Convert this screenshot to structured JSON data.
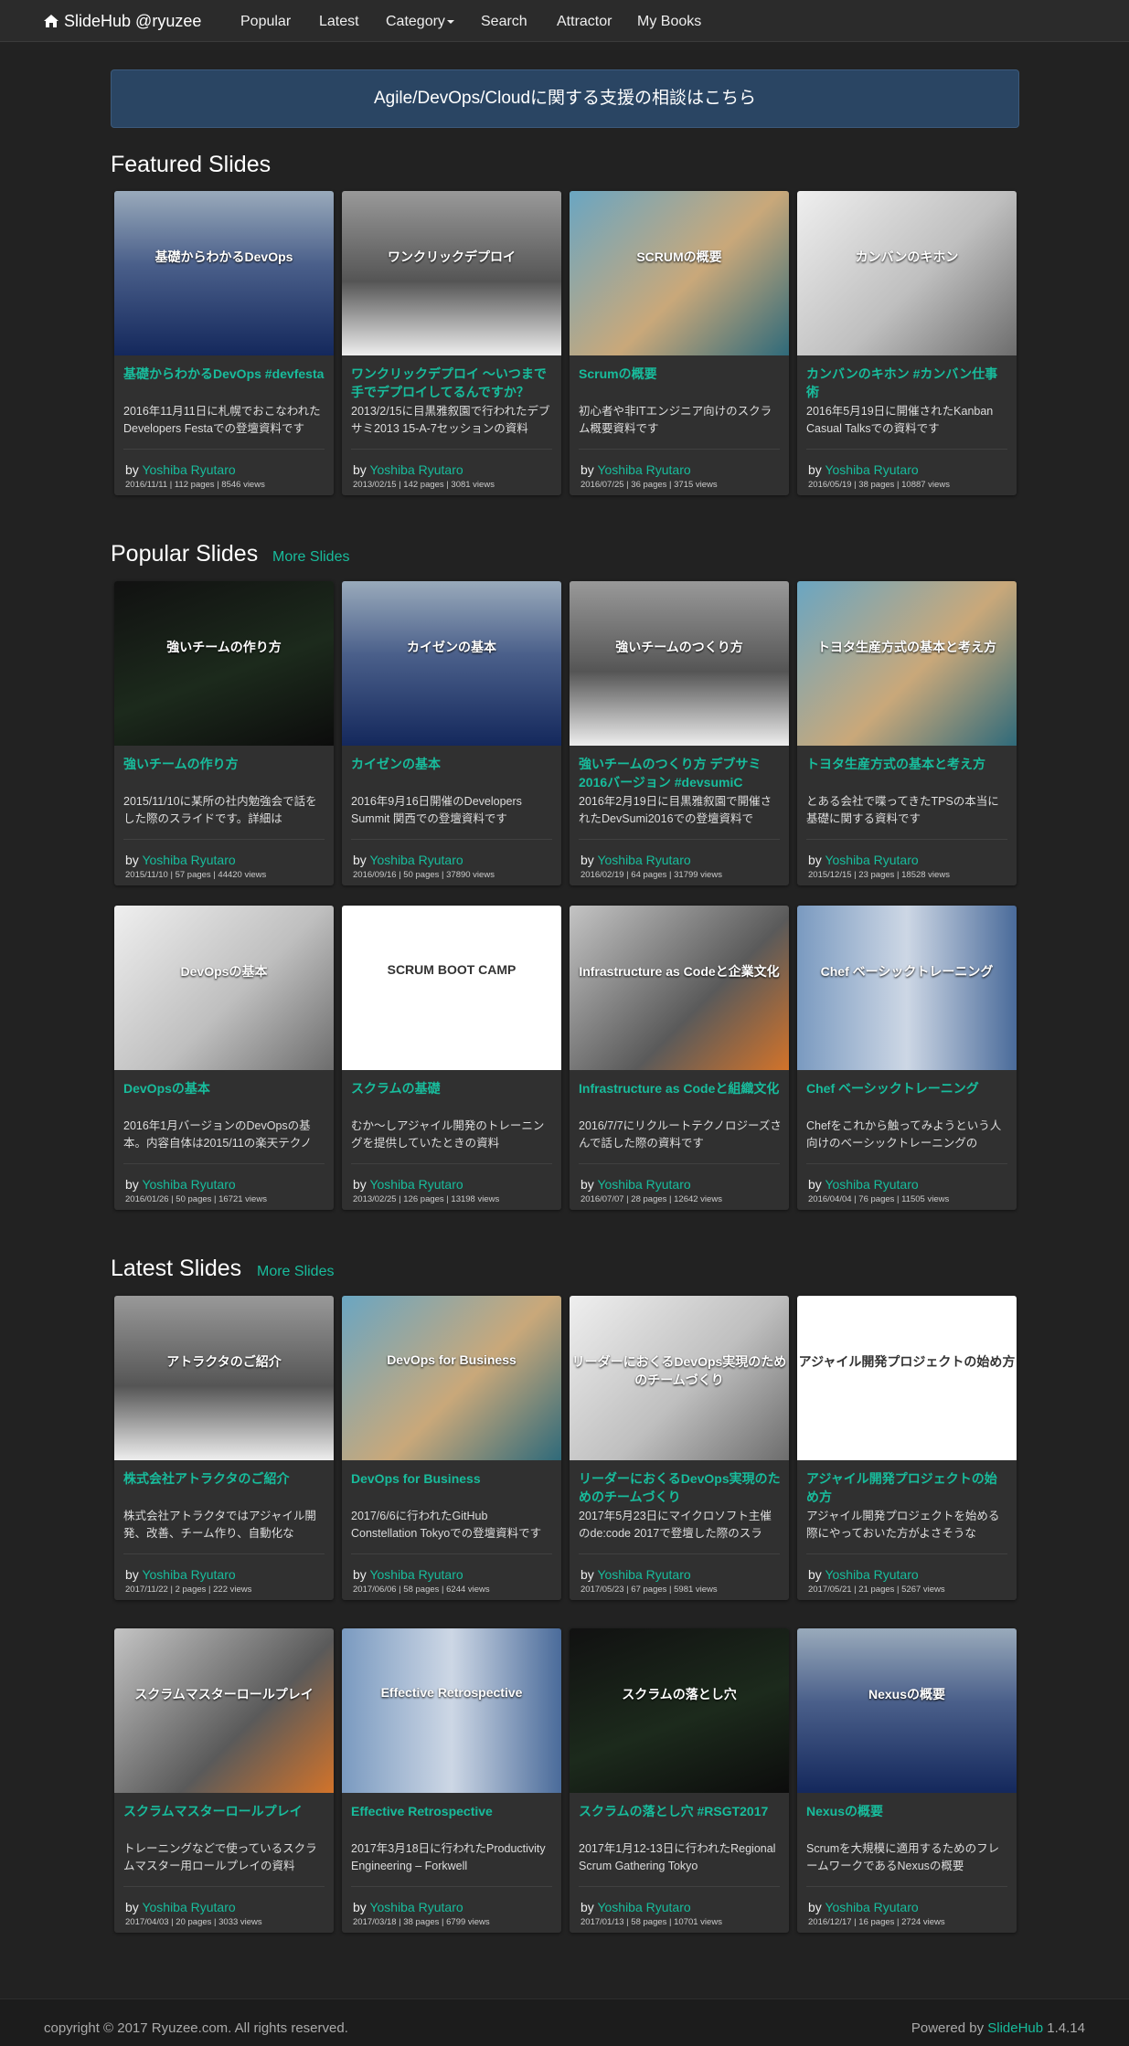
{
  "nav": {
    "brand": "SlideHub @ryuzee",
    "items": [
      "Popular",
      "Latest",
      "Category",
      "Search",
      "Attractor",
      "My Books"
    ]
  },
  "banner": {
    "text": "Agile/DevOps/Cloudに関する支援の相談はこちら"
  },
  "featured": {
    "title": "Featured Slides",
    "cards": [
      {
        "thumb_text": "基礎からわかるDevOps",
        "title": "基礎からわかるDevOps #devfesta",
        "desc": "2016年11月11日に札幌でおこなわれたDevelopers Festaでの登壇資料です",
        "by": "by ",
        "author": "Yoshiba Ryutaro",
        "meta": "2016/11/11 | 112 pages | 8546 views"
      },
      {
        "thumb_text": "ワンクリックデプロイ",
        "title": "ワンクリックデプロイ 〜いつまで手でデプロイしてるんですか？ #devsumiA",
        "desc": "2013/2/15に目黒雅叙園で行われたデブサミ2013 15-A-7セッションの資料",
        "by": "by ",
        "author": "Yoshiba Ryutaro",
        "meta": "2013/02/15 | 142 pages | 3081 views"
      },
      {
        "thumb_text": "SCRUMの概要",
        "title": "Scrumの概要",
        "desc": "初心者や非ITエンジニア向けのスクラム概要資料です",
        "by": "by ",
        "author": "Yoshiba Ryutaro",
        "meta": "2016/07/25 | 36 pages | 3715 views"
      },
      {
        "thumb_text": "カンバンのキホン",
        "title": "カンバンのキホン #カンバン仕事術",
        "desc": "2016年5月19日に開催されたKanban Casual Talksでの資料です",
        "by": "by ",
        "author": "Yoshiba Ryutaro",
        "meta": "2016/05/19 | 38 pages | 10887 views"
      }
    ]
  },
  "popular": {
    "title": "Popular Slides",
    "more": "More Slides",
    "cards": [
      {
        "thumb_text": "強いチームの作り方",
        "title": "強いチームの作り方",
        "desc": "2015/11/10に某所の社内勉強会で話をした際のスライドです。詳細は",
        "by": "by ",
        "author": "Yoshiba Ryutaro",
        "meta": "2015/11/10 | 57 pages | 44420 views"
      },
      {
        "thumb_text": "カイゼンの基本",
        "title": "カイゼンの基本",
        "desc": "2016年9月16日開催のDevelopers Summit 関西での登壇資料です",
        "by": "by ",
        "author": "Yoshiba Ryutaro",
        "meta": "2016/09/16 | 50 pages | 37890 views"
      },
      {
        "thumb_text": "強いチームのつくり方",
        "title": "強いチームのつくり方 デブサミ2016バージョン #devsumiC",
        "desc": "2016年2月19日に目黒雅叙園で開催されたDevSumi2016での登壇資料で",
        "by": "by ",
        "author": "Yoshiba Ryutaro",
        "meta": "2016/02/19 | 64 pages | 31799 views"
      },
      {
        "thumb_text": "トヨタ生産方式の基本と考え方",
        "title": "トヨタ生産方式の基本と考え方",
        "desc": "とある会社で喋ってきたTPSの本当に基礎に関する資料です",
        "by": "by ",
        "author": "Yoshiba Ryutaro",
        "meta": "2015/12/15 | 23 pages | 18528 views"
      },
      {
        "thumb_text": "DevOpsの基本",
        "title": "DevOpsの基本",
        "desc": "2016年1月バージョンのDevOpsの基本。内容自体は2015/11の楽天テクノ",
        "by": "by ",
        "author": "Yoshiba Ryutaro",
        "meta": "2016/01/26 | 50 pages | 16721 views"
      },
      {
        "thumb_text": "SCRUM BOOT CAMP",
        "title": "スクラムの基礎",
        "desc": "むか〜しアジャイル開発のトレーニングを提供していたときの資料",
        "by": "by ",
        "author": "Yoshiba Ryutaro",
        "meta": "2013/02/25 | 126 pages | 13198 views"
      },
      {
        "thumb_text": "Infrastructure as Codeと企業文化",
        "title": "Infrastructure as Codeと組織文化",
        "desc": "2016/7/7にリクルートテクノロジーズさんで話した際の資料です",
        "by": "by ",
        "author": "Yoshiba Ryutaro",
        "meta": "2016/07/07 | 28 pages | 12642 views"
      },
      {
        "thumb_text": "Chef ベーシックトレーニング",
        "title": "Chef ベーシックトレーニング",
        "desc": "Chefをこれから触ってみようという人向けのベーシックトレーニングの",
        "by": "by ",
        "author": "Yoshiba Ryutaro",
        "meta": "2016/04/04 | 76 pages | 11505 views"
      }
    ]
  },
  "latest": {
    "title": "Latest Slides",
    "more": "More Slides",
    "cards": [
      {
        "thumb_text": "アトラクタのご紹介",
        "title": "株式会社アトラクタのご紹介",
        "desc": "株式会社アトラクタではアジャイル開発、改善、チーム作り、自動化な",
        "by": "by ",
        "author": "Yoshiba Ryutaro",
        "meta": "2017/11/22 | 2 pages | 222 views"
      },
      {
        "thumb_text": "DevOps for Business",
        "title": "DevOps for Business",
        "desc": "2017/6/6に行われたGitHub Constellation Tokyoでの登壇資料です",
        "by": "by ",
        "author": "Yoshiba Ryutaro",
        "meta": "2017/06/06 | 58 pages | 6244 views"
      },
      {
        "thumb_text": "リーダーにおくるDevOps実現のためのチームづくり",
        "title": "リーダーにおくるDevOps実現のためのチームづくり",
        "desc": "2017年5月23日にマイクロソフト主催のde:code 2017で登壇した際のスラ",
        "by": "by ",
        "author": "Yoshiba Ryutaro",
        "meta": "2017/05/23 | 67 pages | 5981 views"
      },
      {
        "thumb_text": "アジャイル開発プロジェクトの始め方",
        "title": "アジャイル開発プロジェクトの始め方",
        "desc": "アジャイル開発プロジェクトを始める際にやっておいた方がよさそうな",
        "by": "by ",
        "author": "Yoshiba Ryutaro",
        "meta": "2017/05/21 | 21 pages | 5267 views"
      },
      {
        "thumb_text": "スクラムマスターロールプレイ",
        "title": "スクラムマスターロールプレイ",
        "desc": "トレーニングなどで使っているスクラムマスター用ロールプレイの資料",
        "by": "by ",
        "author": "Yoshiba Ryutaro",
        "meta": "2017/04/03 | 20 pages | 3033 views"
      },
      {
        "thumb_text": "Effective Retrospective",
        "title": "Effective Retrospective",
        "desc": "2017年3月18日に行われたProductivity Engineering – Forkwell",
        "by": "by ",
        "author": "Yoshiba Ryutaro",
        "meta": "2017/03/18 | 38 pages | 6799 views"
      },
      {
        "thumb_text": "スクラムの落とし穴",
        "title": "スクラムの落とし穴 #RSGT2017",
        "desc": "2017年1月12-13日に行われたRegional Scrum Gathering Tokyo",
        "by": "by ",
        "author": "Yoshiba Ryutaro",
        "meta": "2017/01/13 | 58 pages | 10701 views"
      },
      {
        "thumb_text": "Nexusの概要",
        "title": "Nexusの概要",
        "desc": "Scrumを大規模に適用するためのフレームワークであるNexusの概要",
        "by": "by ",
        "author": "Yoshiba Ryutaro",
        "meta": "2016/12/17 | 16 pages | 2724 views"
      }
    ]
  },
  "footer": {
    "copyright": "copyright © 2017 Ryuzee.com. All rights reserved.",
    "powered_prefix": "Powered by ",
    "powered_link": "SlideHub",
    "version": " 1.4.14"
  }
}
